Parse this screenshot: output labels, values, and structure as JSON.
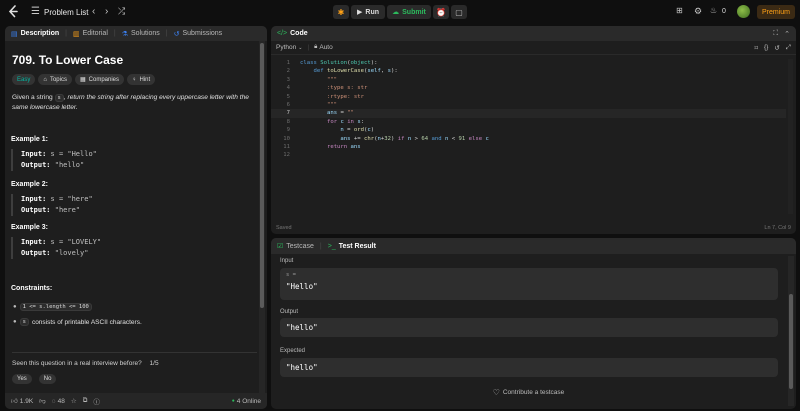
{
  "topbar": {
    "problem_list": "Problem List",
    "run": "Run",
    "submit": "Submit",
    "streak": "0",
    "premium": "Premium"
  },
  "left": {
    "tabs": [
      "Description",
      "Editorial",
      "Solutions",
      "Submissions"
    ],
    "title": "709. To Lower Case",
    "chips": {
      "difficulty": "Easy",
      "topics": "Topics",
      "companies": "Companies",
      "hint": "Hint"
    },
    "desc": {
      "a": "Given a string ",
      "s": "s",
      "b": ", return the string after replacing every uppercase letter with the same lowercase letter."
    },
    "examples": [
      {
        "label": "Example 1:",
        "input_label": "Input:",
        "input": " s = \"Hello\"",
        "output_label": "Output:",
        "output": " \"hello\""
      },
      {
        "label": "Example 2:",
        "input_label": "Input:",
        "input": " s = \"here\"",
        "output_label": "Output:",
        "output": " \"here\""
      },
      {
        "label": "Example 3:",
        "input_label": "Input:",
        "input": " s = \"LOVELY\"",
        "output_label": "Output:",
        "output": " \"lovely\""
      }
    ],
    "constraints": {
      "label": "Constraints:",
      "c1": "1 <= s.length <= 100",
      "c2_code": "s",
      "c2_text": " consists of printable ASCII characters."
    },
    "interview": {
      "q": "Seen this question in a real interview before?",
      "count": "1/5",
      "yes": "Yes",
      "no": "No"
    },
    "footer": {
      "likes": "1.9K",
      "comments": "48",
      "online": "4 Online"
    }
  },
  "code": {
    "title": "Code",
    "language": "Python",
    "mode": "Auto",
    "saved": "Saved",
    "position": "Ln 7, Col 9",
    "lines": [
      {
        "n": "1",
        "t": "class Solution(object):"
      },
      {
        "n": "2",
        "t": "    def toLowerCase(self, s):"
      },
      {
        "n": "3",
        "t": "        \"\"\""
      },
      {
        "n": "4",
        "t": "        :type s: str"
      },
      {
        "n": "5",
        "t": "        :rtype: str"
      },
      {
        "n": "6",
        "t": "        \"\"\""
      },
      {
        "n": "7",
        "t": "        ans = \"\""
      },
      {
        "n": "8",
        "t": "        for c in s:"
      },
      {
        "n": "9",
        "t": "            n = ord(c)"
      },
      {
        "n": "10",
        "t": "            ans += chr(n+32) if n > 64 and n < 91 else c"
      },
      {
        "n": "11",
        "t": "        return ans"
      },
      {
        "n": "12",
        "t": ""
      }
    ]
  },
  "result": {
    "tabs": {
      "testcase": "Testcase",
      "test_result": "Test Result"
    },
    "input_label": "Input",
    "var": "s =",
    "input_val": "\"Hello\"",
    "output_label": "Output",
    "output_val": "\"hello\"",
    "expected_label": "Expected",
    "expected_val": "\"hello\"",
    "contribute": "Contribute a testcase"
  },
  "colors": {
    "accent_green": "#2cbb5d",
    "premium": "#ffa116",
    "tab_blue": "#3b82f6",
    "easy": "#00b8a3"
  }
}
